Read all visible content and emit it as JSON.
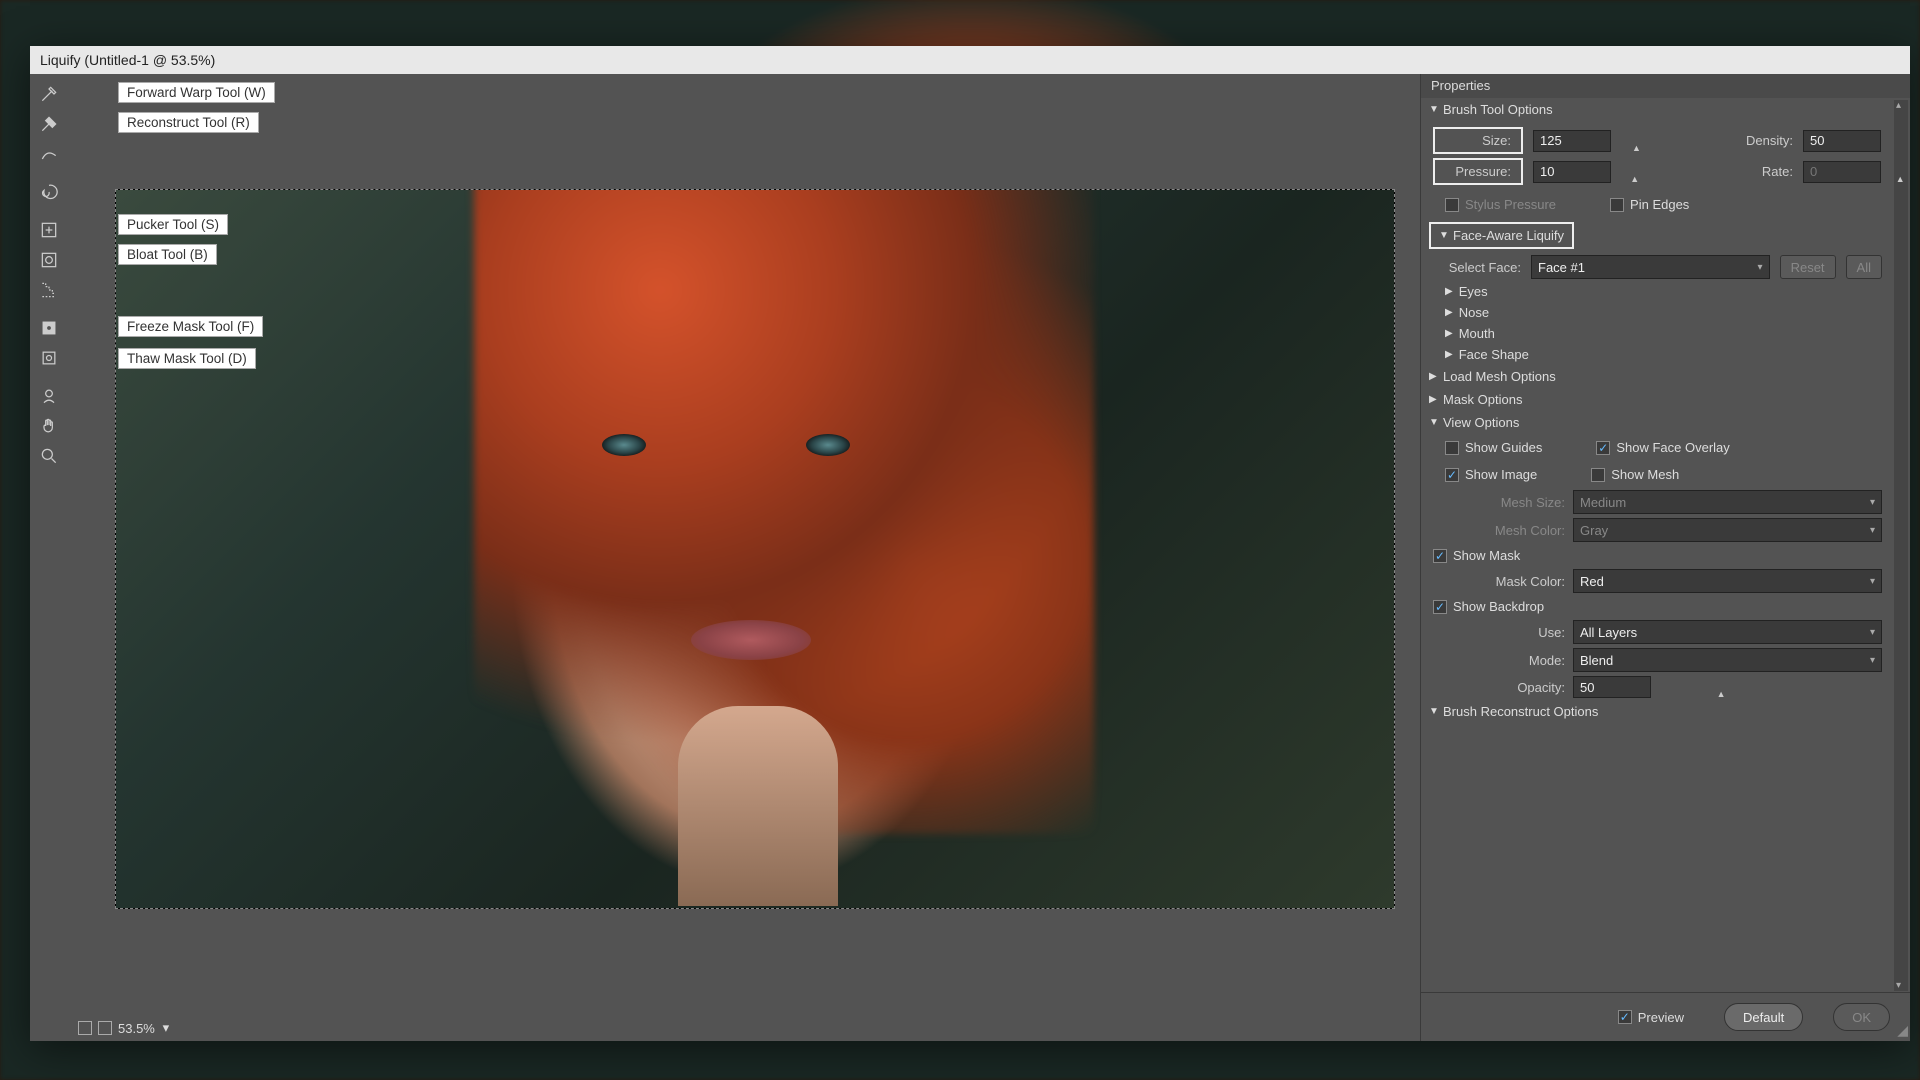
{
  "window": {
    "title": "Liquify (Untitled-1 @ 53.5%)"
  },
  "tools": {
    "tooltips": {
      "forward_warp": "Forward Warp Tool (W)",
      "reconstruct": "Reconstruct Tool (R)",
      "pucker": "Pucker Tool (S)",
      "bloat": "Bloat Tool (B)",
      "freeze": "Freeze Mask Tool (F)",
      "thaw": "Thaw Mask Tool (D)"
    }
  },
  "status": {
    "zoom": "53.5%"
  },
  "panel": {
    "title": "Properties",
    "brush_tool_options": {
      "header": "Brush Tool Options",
      "size_label": "Size:",
      "size_value": "125",
      "density_label": "Density:",
      "density_value": "50",
      "pressure_label": "Pressure:",
      "pressure_value": "10",
      "rate_label": "Rate:",
      "rate_value": "0",
      "stylus_label": "Stylus Pressure",
      "pin_edges_label": "Pin Edges"
    },
    "face_aware": {
      "header": "Face-Aware Liquify",
      "select_face_label": "Select Face:",
      "select_face_value": "Face #1",
      "reset_label": "Reset",
      "all_label": "All",
      "eyes": "Eyes",
      "nose": "Nose",
      "mouth": "Mouth",
      "face_shape": "Face Shape"
    },
    "load_mesh": {
      "header": "Load Mesh Options"
    },
    "mask_options": {
      "header": "Mask Options"
    },
    "view_options": {
      "header": "View Options",
      "show_guides": "Show Guides",
      "show_face_overlay": "Show Face Overlay",
      "show_image": "Show Image",
      "show_mesh": "Show Mesh",
      "mesh_size_label": "Mesh Size:",
      "mesh_size_value": "Medium",
      "mesh_color_label": "Mesh Color:",
      "mesh_color_value": "Gray",
      "show_mask": "Show Mask",
      "mask_color_label": "Mask Color:",
      "mask_color_value": "Red",
      "show_backdrop": "Show Backdrop",
      "use_label": "Use:",
      "use_value": "All Layers",
      "mode_label": "Mode:",
      "mode_value": "Blend",
      "opacity_label": "Opacity:",
      "opacity_value": "50"
    },
    "brush_reconstruct": {
      "header": "Brush Reconstruct Options"
    },
    "preview_label": "Preview",
    "default_label": "Default",
    "ok_label": "OK"
  }
}
